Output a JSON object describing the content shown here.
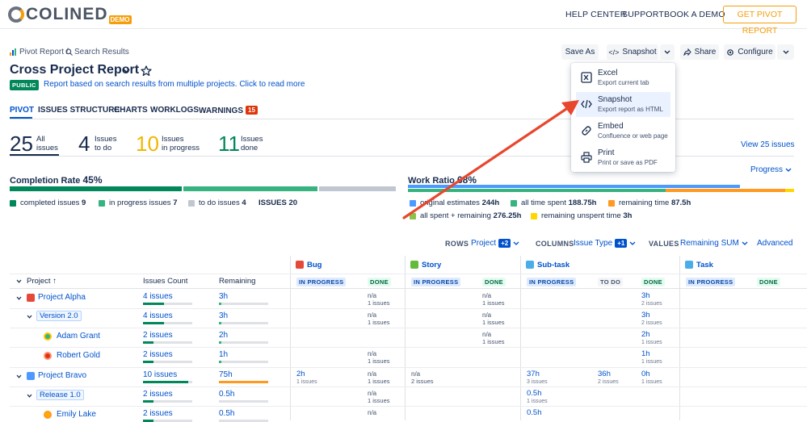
{
  "topbar": {
    "logo_text": "COLINED",
    "logo_badge": "DEMO",
    "nav": [
      "HELP CENTER",
      "SUPPORT",
      "BOOK A DEMO"
    ],
    "cta": "GET PIVOT REPORT"
  },
  "breadcrumb": {
    "first": "Pivot Report /",
    "second": "Search Results"
  },
  "report": {
    "title": "Cross Project Report",
    "badge": "PUBLIC",
    "description": "Report based on search results from multiple projects. Click to read more"
  },
  "toolbar": {
    "save_as": "Save As",
    "snapshot": "Snapshot",
    "share": "Share",
    "configure": "Configure"
  },
  "menu": {
    "items": [
      {
        "title": "Excel",
        "subtitle": "Export current tab",
        "icon": "excel-icon"
      },
      {
        "title": "Snapshot",
        "subtitle": "Export report as HTML",
        "icon": "code-icon"
      },
      {
        "title": "Embed",
        "subtitle": "Confluence or web page",
        "icon": "link-icon"
      },
      {
        "title": "Print",
        "subtitle": "Print or save as PDF",
        "icon": "printer-icon"
      }
    ]
  },
  "tabs": [
    {
      "label": "PIVOT"
    },
    {
      "label": "ISSUES STRUCTURE"
    },
    {
      "label": "CHARTS"
    },
    {
      "label": "WORKLOGS"
    },
    {
      "label": "WARNINGS",
      "badge": "15"
    }
  ],
  "summary": {
    "items": [
      {
        "value": "25",
        "caption1": "All",
        "caption2": "issues",
        "color": "#172b4d"
      },
      {
        "value": "4",
        "caption1": "Issues",
        "caption2": "to do",
        "color": "#172b4d"
      },
      {
        "value": "10",
        "caption1": "Issues",
        "caption2": "in progress",
        "color": "#f2b600"
      },
      {
        "value": "11",
        "caption1": "Issues",
        "caption2": "done",
        "color": "#00875a"
      }
    ],
    "view_link": "View 25 issues"
  },
  "completion": {
    "label": "Completion Rate",
    "pct": "45%",
    "legend": [
      {
        "label": "completed issues",
        "value": "9",
        "color": "#00875a",
        "fraction": 0.45
      },
      {
        "label": "in progress issues",
        "value": "7",
        "color": "#36b37e",
        "fraction": 0.35
      },
      {
        "label": "to do issues",
        "value": "4",
        "color": "#c1c7d0",
        "fraction": 0.2
      }
    ],
    "issues_label": "ISSUES",
    "issues_value": "20"
  },
  "work_ratio": {
    "label": "Work Ratio",
    "pct": "68%",
    "dropdown": "Progress",
    "legend": [
      {
        "label": "original estimates",
        "value": "244h",
        "color": "#4c9aff"
      },
      {
        "label": "all time spent",
        "value": "188.75h",
        "color": "#36b37e"
      },
      {
        "label": "remaining time",
        "value": "87.5h",
        "color": "#ff991f"
      },
      {
        "label": "all spent + remaining",
        "value": "276.25h",
        "color": "#8bc34a"
      },
      {
        "label": "remaining unspent time",
        "value": "3h",
        "color": "#ffd700"
      }
    ]
  },
  "controls": {
    "rows_label": "ROWS",
    "rows_value": "Project",
    "rows_count": "+2",
    "columns_label": "COLUMNS",
    "columns_value": "Issue Type",
    "columns_count": "+1",
    "values_label": "VALUES",
    "values_value": "Remaining SUM",
    "advanced": "Advanced"
  },
  "table": {
    "groups": [
      {
        "name": "Bug",
        "color": "#e5493a",
        "statuses": [
          "IN PROGRESS",
          "DONE"
        ]
      },
      {
        "name": "Story",
        "color": "#63ba3c",
        "statuses": [
          "IN PROGRESS",
          "DONE"
        ]
      },
      {
        "name": "Sub-task",
        "color": "#4bade8",
        "statuses": [
          "IN PROGRESS",
          "TO DO",
          "DONE"
        ]
      },
      {
        "name": "Task",
        "color": "#4bade8",
        "statuses": [
          "IN PROGRESS",
          "DONE"
        ]
      }
    ],
    "headers": {
      "project": "Project",
      "count": "Issues Count",
      "remaining": "Remaining"
    },
    "rows": [
      {
        "label": "Project Alpha",
        "count": "4 issues",
        "remaining": "3h",
        "count_frac": 0.0,
        "rem_frac": 0.05,
        "rem_color": "#36b37e",
        "cells": [
          {
            "col": 1,
            "v": "n/a",
            "s": "1 issues",
            "na": true
          },
          {
            "col": 3,
            "v": "n/a",
            "s": "1 issues",
            "na": true
          },
          {
            "col": 6,
            "v": "3h",
            "s": "2 issues"
          }
        ]
      },
      {
        "label": "Version 2.0",
        "count": "4 issues",
        "remaining": "3h",
        "count_frac": 0.0,
        "rem_frac": 0.05,
        "rem_color": "#36b37e",
        "cells": [
          {
            "col": 1,
            "v": "n/a",
            "s": "1 issues",
            "na": true
          },
          {
            "col": 3,
            "v": "n/a",
            "s": "1 issues",
            "na": true
          },
          {
            "col": 6,
            "v": "3h",
            "s": "2 issues"
          }
        ]
      },
      {
        "label": "Adam Grant",
        "count": "2 issues",
        "remaining": "2h",
        "count_frac": 0.0,
        "rem_frac": 0.05,
        "rem_color": "#36b37e",
        "cells": [
          {
            "col": 3,
            "v": "n/a",
            "s": "1 issues",
            "na": true
          },
          {
            "col": 6,
            "v": "2h",
            "s": "1 issues"
          }
        ]
      },
      {
        "label": "Robert Gold",
        "count": "2 issues",
        "remaining": "1h",
        "count_frac": 0.0,
        "rem_frac": 0.05,
        "rem_color": "#36b37e",
        "cells": [
          {
            "col": 1,
            "v": "n/a",
            "s": "1 issues",
            "na": true
          },
          {
            "col": 6,
            "v": "1h",
            "s": "1 issues"
          }
        ]
      },
      {
        "label": "Project Bravo",
        "count": "10 issues",
        "remaining": "75h",
        "count_frac": 0.9,
        "rem_frac": 1.0,
        "rem_color": "#ff991f",
        "cells": [
          {
            "col": 0,
            "v": "2h",
            "s": "1 issues"
          },
          {
            "col": 1,
            "v": "n/a",
            "s": "1 issues",
            "na": true
          },
          {
            "col": 2,
            "v": "n/a",
            "s": "2 issues",
            "na": true
          },
          {
            "col": 4,
            "v": "37h",
            "s": "3 issues"
          },
          {
            "col": 5,
            "v": "36h",
            "s": "2 issues"
          },
          {
            "col": 6,
            "v": "0h",
            "s": "1 issues"
          }
        ]
      },
      {
        "label": "Release 1.0",
        "count": "2 issues",
        "remaining": "0.5h",
        "count_frac": 0.0,
        "rem_frac": 0.0,
        "rem_color": "#36b37e",
        "cells": [
          {
            "col": 1,
            "v": "n/a",
            "s": "1 issues",
            "na": true
          },
          {
            "col": 4,
            "v": "0.5h",
            "s": "1 issues"
          }
        ]
      },
      {
        "label": "Emily Lake",
        "count": "2 issues",
        "remaining": "0.5h",
        "count_frac": 0.0,
        "rem_frac": 0.0,
        "rem_color": "#36b37e",
        "cells": [
          {
            "col": 1,
            "v": "n/a",
            "s": "",
            "na": true
          },
          {
            "col": 4,
            "v": "0.5h",
            "s": ""
          }
        ]
      }
    ]
  }
}
